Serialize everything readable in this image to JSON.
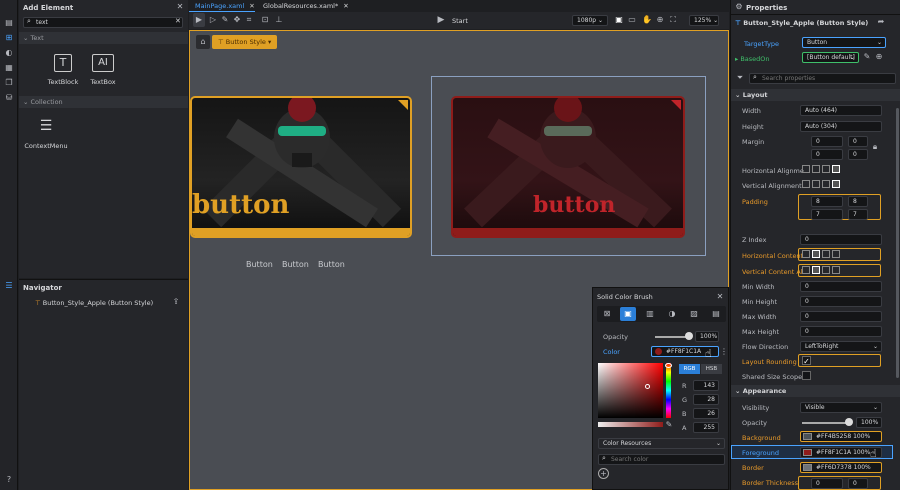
{
  "left_panel": {
    "title": "Add Element",
    "search_value": "text",
    "text_section": "Text",
    "items": [
      {
        "label": "TextBlock"
      },
      {
        "label": "TextBox"
      }
    ],
    "collection_section": "Collection",
    "collection_items": [
      {
        "label": "ContextMenu"
      }
    ]
  },
  "navigator": {
    "title": "Navigator",
    "item": "Button_Style_Apple (Button Style)"
  },
  "tabs": [
    {
      "label": "MainPage.xaml"
    },
    {
      "label": "GlobalResources.xaml*"
    }
  ],
  "toolbar": {
    "start": "Start",
    "resolution": "1080p",
    "zoom": "125%"
  },
  "canvas": {
    "breadcrumb": "Button Style",
    "button_text_left": "button",
    "button_text_right": "button",
    "captions": [
      "Button",
      "Button",
      "Button"
    ]
  },
  "color_popup": {
    "title": "Solid Color Brush",
    "opacity_label": "Opacity",
    "opacity_value": "100%",
    "color_label": "Color",
    "color_value": "#FF8F1C1A",
    "mode_rgb": "RGB",
    "mode_hsb": "HSB",
    "r": "143",
    "g": "28",
    "b": "26",
    "a": "255",
    "r_label": "R",
    "g_label": "G",
    "b_label": "B",
    "a_label": "A",
    "resources": "Color Resources",
    "search_placeholder": "Search color"
  },
  "properties": {
    "title": "Properties",
    "target": "Button_Style_Apple (Button Style)",
    "target_type_label": "TargetType",
    "target_type_value": "Button",
    "based_on_label": "BasedOn",
    "based_on_value": "[Button default]",
    "search_placeholder": "Search properties",
    "layout_section": "Layout",
    "width_label": "Width",
    "width_value": "Auto (464)",
    "height_label": "Height",
    "height_value": "Auto (304)",
    "margin_label": "Margin",
    "margin": [
      "0",
      "0",
      "0",
      "0"
    ],
    "h_align_label": "Horizontal Alignme...",
    "v_align_label": "Vertical Alignment",
    "padding_label": "Padding",
    "padding": [
      "8",
      "8",
      "7",
      "7"
    ],
    "zindex_label": "Z Index",
    "zindex_value": "0",
    "hcontent_label": "Horizontal Content...",
    "vcontent_label": "Vertical Content Al...",
    "minw_label": "Min Width",
    "minw_value": "0",
    "minh_label": "Min Height",
    "minh_value": "0",
    "maxw_label": "Max Width",
    "maxw_value": "0",
    "maxh_label": "Max Height",
    "maxh_value": "0",
    "flow_label": "Flow Direction",
    "flow_value": "LeftToRight",
    "rounding_label": "Layout Rounding",
    "sizescope_label": "Shared Size Scope",
    "appearance_section": "Appearance",
    "visibility_label": "Visibility",
    "visibility_value": "Visible",
    "opacity_label": "Opacity",
    "opacity_value": "100%",
    "background_label": "Background",
    "background_value": "#FF4B5258",
    "background_pct": "100%",
    "foreground_label": "Foreground",
    "foreground_value": "#FF8F1C1A",
    "foreground_pct": "100%",
    "border_label": "Border",
    "border_value": "#FF6D7378",
    "border_pct": "100%",
    "thickness_label": "Border Thickness",
    "thickness": [
      "0",
      "0"
    ]
  },
  "colors": {
    "accent": "#e0a024",
    "blue": "#4aa3ff",
    "bg_swatch": "#4b5258",
    "fg_swatch": "#8f1c1a",
    "border_swatch": "#6d7378"
  }
}
